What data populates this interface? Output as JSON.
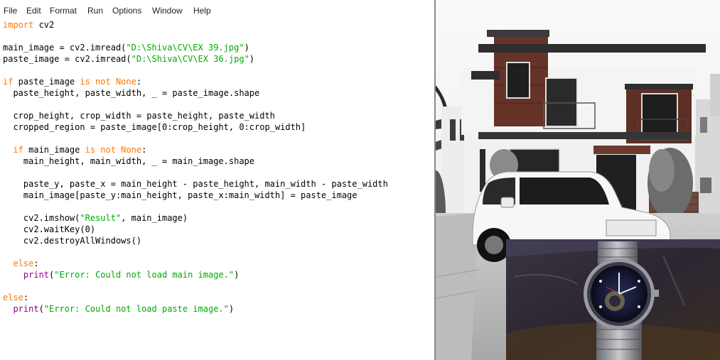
{
  "menu": [
    "File",
    "Edit",
    "Format",
    "Run",
    "Options",
    "Window",
    "Help"
  ],
  "code_lines": [
    [
      {
        "t": "import",
        "c": "kw"
      },
      {
        "t": " cv2"
      }
    ],
    [],
    [
      {
        "t": "main_image = cv2.imread("
      },
      {
        "t": "\"D:\\Shiva\\CV\\EX 39.jpg\"",
        "c": "str"
      },
      {
        "t": ")"
      }
    ],
    [
      {
        "t": "paste_image = cv2.imread("
      },
      {
        "t": "\"D:\\Shiva\\CV\\EX 36.jpg\"",
        "c": "str"
      },
      {
        "t": ")"
      }
    ],
    [],
    [
      {
        "t": "if",
        "c": "kw"
      },
      {
        "t": " paste_image "
      },
      {
        "t": "is not None",
        "c": "kw"
      },
      {
        "t": ":"
      }
    ],
    [
      {
        "t": "  paste_height, paste_width, _ = paste_image.shape"
      }
    ],
    [],
    [
      {
        "t": "  crop_height, crop_width = paste_height, paste_width"
      }
    ],
    [
      {
        "t": "  cropped_region = paste_image[0:crop_height, 0:crop_width]"
      }
    ],
    [],
    [
      {
        "t": "  "
      },
      {
        "t": "if",
        "c": "kw"
      },
      {
        "t": " main_image "
      },
      {
        "t": "is not None",
        "c": "kw"
      },
      {
        "t": ":"
      }
    ],
    [
      {
        "t": "    main_height, main_width, _ = main_image.shape"
      }
    ],
    [],
    [
      {
        "t": "    paste_y, paste_x = main_height - paste_height, main_width - paste_width"
      }
    ],
    [
      {
        "t": "    main_image[paste_y:main_height, paste_x:main_width] = paste_image"
      }
    ],
    [],
    [
      {
        "t": "    cv2.imshow("
      },
      {
        "t": "\"Result\"",
        "c": "str"
      },
      {
        "t": ", main_image)"
      }
    ],
    [
      {
        "t": "    cv2.waitKey(0)"
      }
    ],
    [
      {
        "t": "    cv2.destroyAllWindows()"
      }
    ],
    [],
    [
      {
        "t": "  "
      },
      {
        "t": "else",
        "c": "kw"
      },
      {
        "t": ":"
      }
    ],
    [
      {
        "t": "    "
      },
      {
        "t": "print",
        "c": "bi"
      },
      {
        "t": "("
      },
      {
        "t": "\"Error: Could not load main image.\"",
        "c": "str"
      },
      {
        "t": ")"
      }
    ],
    [],
    [
      {
        "t": "else",
        "c": "kw"
      },
      {
        "t": ":"
      }
    ],
    [
      {
        "t": "  "
      },
      {
        "t": "print",
        "c": "bi"
      },
      {
        "t": "("
      },
      {
        "t": "\"Error: Could not load paste image.\"",
        "c": "str"
      },
      {
        "t": ")"
      }
    ]
  ],
  "colors": {
    "keyword": "#ff7700",
    "string": "#00aa00",
    "builtin": "#900090",
    "text": "#000000"
  }
}
